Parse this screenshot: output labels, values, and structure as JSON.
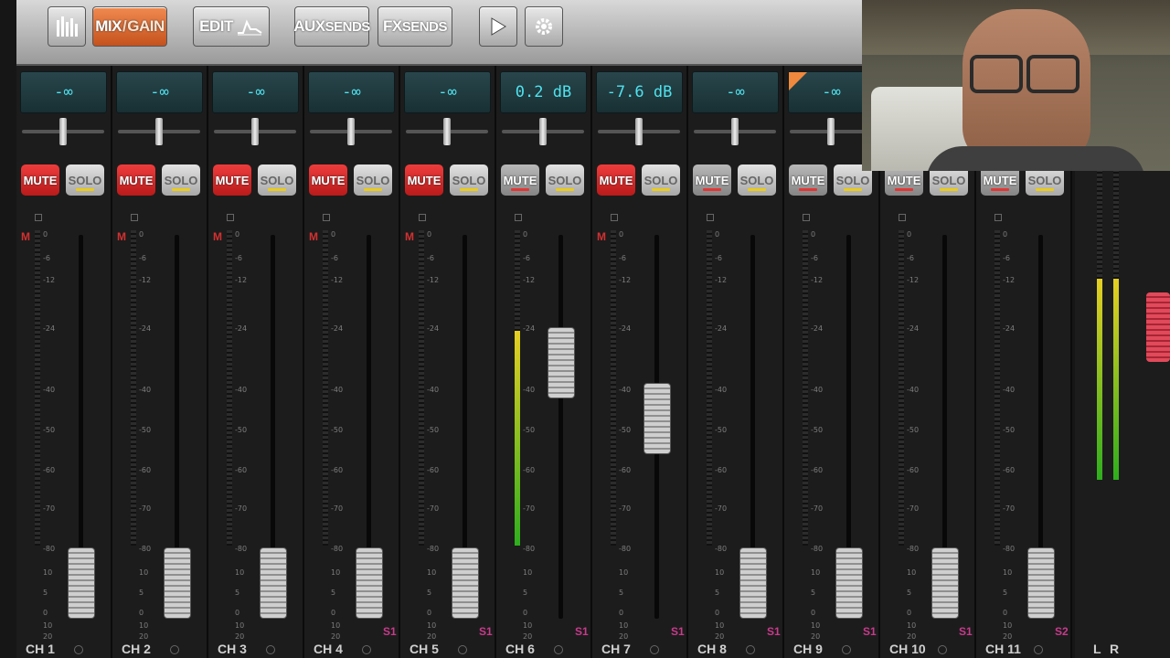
{
  "toolbar": {
    "meters_label": "",
    "mix_label": "MIX",
    "gain_label": "GAIN",
    "edit_label": "EDIT",
    "aux_label": "AUX",
    "aux_sub": "SENDS",
    "fx_label": "FX",
    "fx_sub": "SENDS",
    "play_icon": "play-icon",
    "settings_icon": "gear-icon"
  },
  "buttons": {
    "mute": "MUTE",
    "solo": "SOLO"
  },
  "scale_ticks": [
    "0",
    "-6",
    "-12",
    "-24",
    "-40",
    "-50",
    "-60",
    "-70",
    "-80",
    "10",
    "5",
    "0",
    "10",
    "20"
  ],
  "channels": [
    {
      "name": "CH 1",
      "gain": "-∞",
      "mute_on": true,
      "fader": 0.05,
      "meter": 0,
      "tag": "",
      "m": true
    },
    {
      "name": "CH 2",
      "gain": "-∞",
      "mute_on": true,
      "fader": 0.05,
      "meter": 0,
      "tag": "",
      "m": true
    },
    {
      "name": "CH 3",
      "gain": "-∞",
      "mute_on": true,
      "fader": 0.05,
      "meter": 0,
      "tag": "",
      "m": true
    },
    {
      "name": "CH 4",
      "gain": "-∞",
      "mute_on": true,
      "fader": 0.05,
      "meter": 0,
      "tag": "S1",
      "m": true
    },
    {
      "name": "CH 5",
      "gain": "-∞",
      "mute_on": true,
      "fader": 0.05,
      "meter": 0,
      "tag": "S1",
      "m": true
    },
    {
      "name": "CH 6",
      "gain": "0.2 dB",
      "mute_on": false,
      "fader": 0.72,
      "meter": 0.68,
      "tag": "S1",
      "m": false
    },
    {
      "name": "CH 7",
      "gain": "-7.6 dB",
      "mute_on": true,
      "fader": 0.55,
      "meter": 0,
      "tag": "S1",
      "m": true
    },
    {
      "name": "CH 8",
      "gain": "-∞",
      "mute_on": false,
      "fader": 0.05,
      "meter": 0,
      "tag": "S1",
      "m": false
    },
    {
      "name": "CH 9",
      "gain": "-∞",
      "mute_on": false,
      "fader": 0.05,
      "meter": 0,
      "tag": "S1",
      "m": false
    },
    {
      "name": "CH 10",
      "gain": "",
      "mute_on": false,
      "fader": 0.05,
      "meter": 0,
      "tag": "S1",
      "m": false
    },
    {
      "name": "CH 11",
      "gain": "",
      "mute_on": false,
      "fader": 0.05,
      "meter": 0,
      "tag": "S2",
      "m": false
    }
  ],
  "master": {
    "left_label": "L",
    "right_label": "R"
  }
}
